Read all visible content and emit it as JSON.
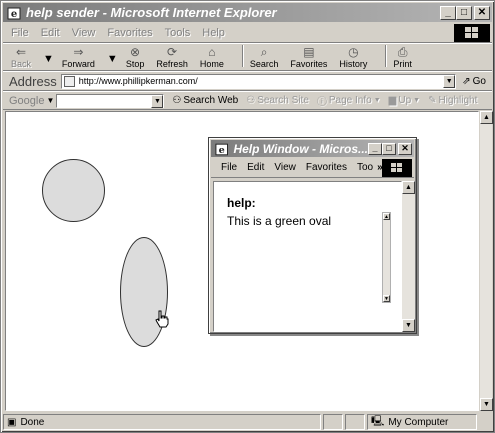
{
  "window": {
    "title": "help sender - Microsoft Internet Explorer"
  },
  "menu": [
    "File",
    "Edit",
    "View",
    "Favorites",
    "Tools",
    "Help"
  ],
  "toolbar": {
    "back": "Back",
    "forward": "Forward",
    "stop": "Stop",
    "refresh": "Refresh",
    "home": "Home",
    "search": "Search",
    "favorites": "Favorites",
    "history": "History",
    "print": "Print"
  },
  "address": {
    "label": "Address",
    "url": "http://www.phillipkerman.com/",
    "go": "Go"
  },
  "googlebar": {
    "logo": "Google",
    "search_web": "Search Web",
    "search_site": "Search Site",
    "page_info": "Page Info",
    "up": "Up",
    "highlight": "Highlight"
  },
  "help_window": {
    "title": "Help Window - Micros...",
    "menu": [
      "File",
      "Edit",
      "View",
      "Favorites",
      "Too"
    ],
    "heading": "help:",
    "text": "This is a green oval"
  },
  "status": {
    "text": "Done",
    "zone": "My Computer"
  }
}
